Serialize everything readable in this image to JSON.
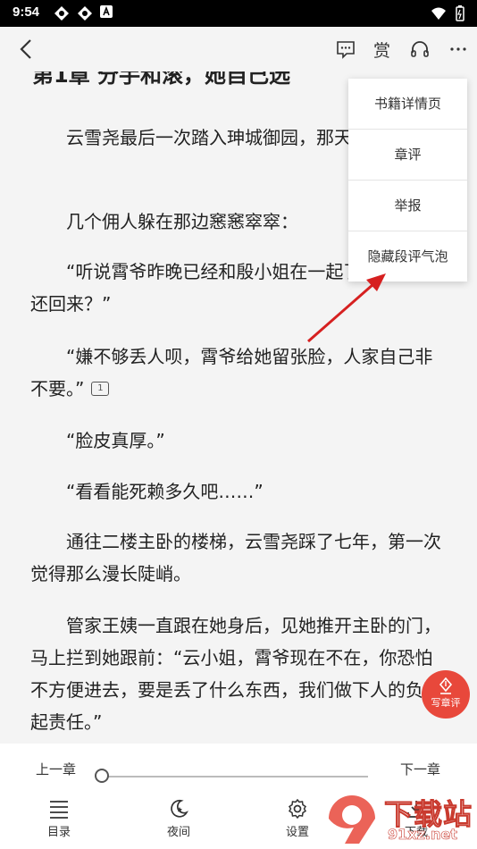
{
  "status": {
    "time": "9:54"
  },
  "chapter_title": "第1章 分手和滚，她自己选",
  "paragraphs": [
    "　　云雪尧最后一次踏入珅城御园，那天风是凉的。",
    "　　几个佣人躲在那边窸窸窣窣：",
    "　　“听说霄爷昨晚已经和殷小姐在一起了，她怎么还回来？”",
    "　　“嫌不够丢人呗，霄爷给她留张脸，人家自己非不要。”",
    "　　“脸皮真厚。”",
    "　　“看看能死赖多久吧……”",
    "　　通往二楼主卧的楼梯，云雪尧踩了七年，第一次觉得那么漫长陡峭。",
    "　　管家王姨一直跟在她身后，见她推开主卧的门，马上拦到她跟前：“云小姐，霄爷现在不在，你恐怕不方便进去，要是丢了什么东西，我们做下人的负不起责任。”"
  ],
  "comment_count": "1",
  "menu": [
    "书籍详情页",
    "章评",
    "举报",
    "隐藏段评气泡"
  ],
  "fab_label": "写章评",
  "nav": {
    "prev": "上一章",
    "next": "下一章",
    "progress": 0
  },
  "toolbar": [
    "目录",
    "夜间",
    "设置",
    "下载"
  ],
  "watermark": {
    "main": "下载站",
    "sub": "91xz.net"
  },
  "colors": {
    "accent": "#e8483b",
    "arrow": "#d62020"
  }
}
